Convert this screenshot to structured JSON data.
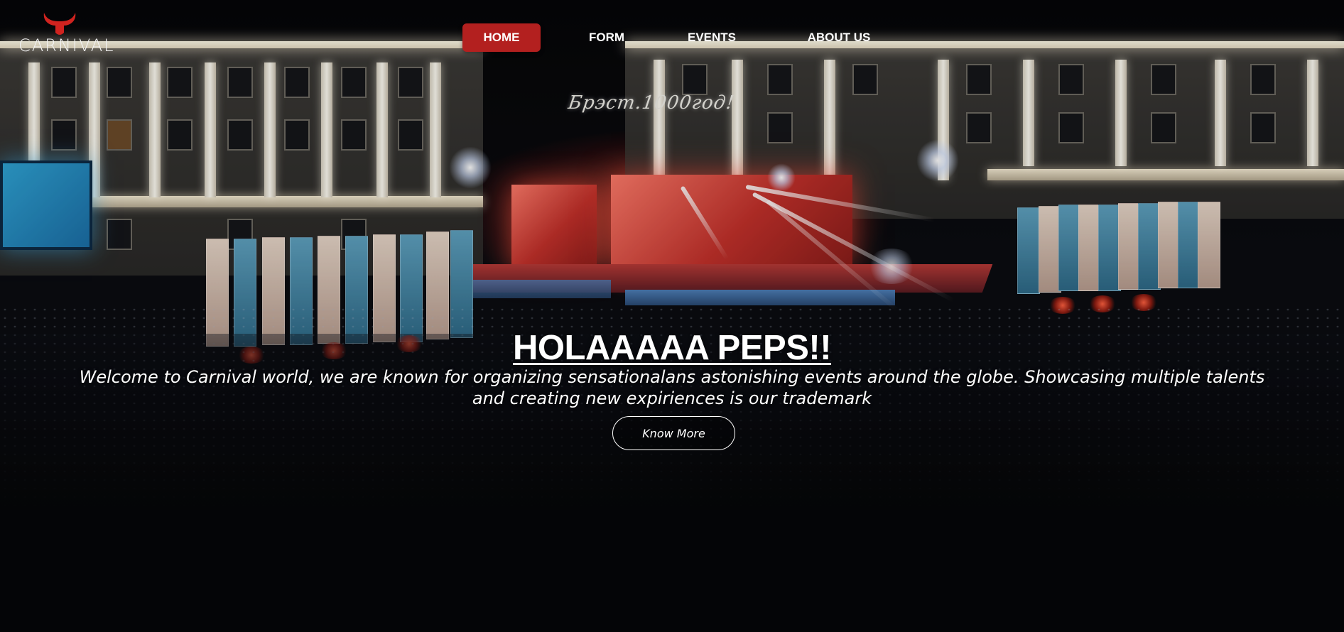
{
  "brand": {
    "logo_text": "CARNIVAL",
    "accent_color": "#b3201f"
  },
  "nav": {
    "items": [
      {
        "label": "HOME",
        "active": true
      },
      {
        "label": "FORM",
        "active": false
      },
      {
        "label": "EVENTS",
        "active": false
      },
      {
        "label": "ABOUT US",
        "active": false
      }
    ]
  },
  "hero": {
    "title": "HOLAAAAA PEPS!!",
    "description": "Welcome to Carnival world, we are known for organizing sensationalans astonishing events around the globe. Showcasing multiple talents and creating new expiriences is our trademark",
    "cta_label": "Know More"
  },
  "background": {
    "sign_text": "Брэст.1000год!",
    "icons": [
      "bull-horns-icon"
    ]
  }
}
